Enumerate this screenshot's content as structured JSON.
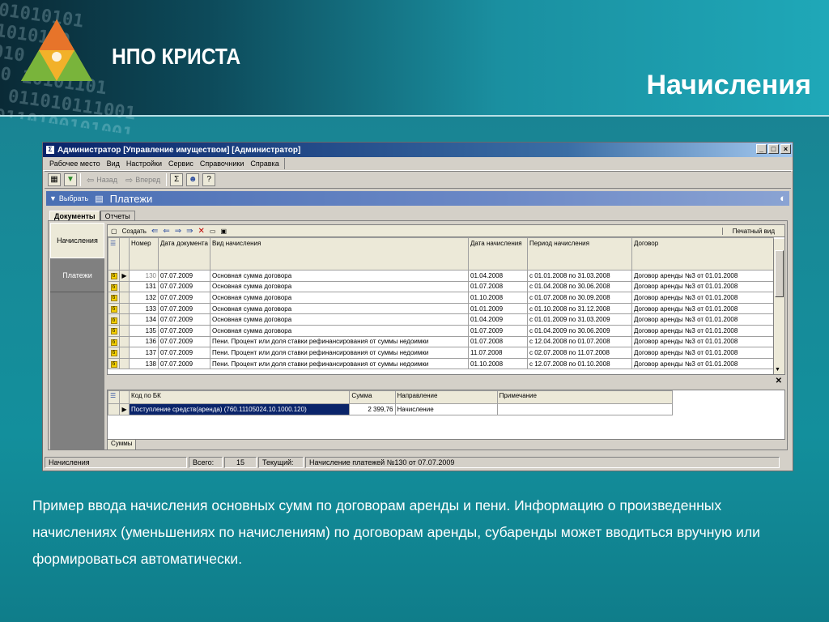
{
  "header": {
    "brand": "НПО КРИСТА",
    "page_title": "Начисления"
  },
  "window": {
    "title": "Администратор [Управление имуществом] [Администратор]",
    "menu": [
      "Рабочее место",
      "Вид",
      "Настройки",
      "Сервис",
      "Справочники",
      "Справка"
    ],
    "toolbar": {
      "back_label": "Назад",
      "forward_label": "Вперед"
    },
    "select_bar": {
      "select_label": "Выбрать",
      "title": "Платежи"
    },
    "tabs": [
      "Документы",
      "Отчеты"
    ],
    "sidebar": [
      "Начисления",
      "Платежи"
    ],
    "grid_toolbar": {
      "create_label": "Создать",
      "print_label": "Печатный вид"
    },
    "grid": {
      "columns": [
        "Номер",
        "Дата документа",
        "Вид начисления",
        "Дата начисления",
        "Период начисления",
        "Договор"
      ],
      "rows": [
        [
          "130",
          "07.07.2009",
          "Основная сумма договора",
          "01.04.2008",
          "с 01.01.2008 по 31.03.2008",
          "Договор аренды №3 от 01.01.2008"
        ],
        [
          "131",
          "07.07.2009",
          "Основная сумма договора",
          "01.07.2008",
          "с 01.04.2008 по 30.06.2008",
          "Договор аренды №3 от 01.01.2008"
        ],
        [
          "132",
          "07.07.2009",
          "Основная сумма договора",
          "01.10.2008",
          "с 01.07.2008 по 30.09.2008",
          "Договор аренды №3 от 01.01.2008"
        ],
        [
          "133",
          "07.07.2009",
          "Основная сумма договора",
          "01.01.2009",
          "с 01.10.2008 по 31.12.2008",
          "Договор аренды №3 от 01.01.2008"
        ],
        [
          "134",
          "07.07.2009",
          "Основная сумма договора",
          "01.04.2009",
          "с 01.01.2009 по 31.03.2009",
          "Договор аренды №3 от 01.01.2008"
        ],
        [
          "135",
          "07.07.2009",
          "Основная сумма договора",
          "01.07.2009",
          "с 01.04.2009 по 30.06.2009",
          "Договор аренды №3 от 01.01.2008"
        ],
        [
          "136",
          "07.07.2009",
          "Пени. Процент или доля ставки рефинансирования от суммы недоимки",
          "01.07.2008",
          "с 12.04.2008 по 01.07.2008",
          "Договор аренды №3 от 01.01.2008"
        ],
        [
          "137",
          "07.07.2009",
          "Пени. Процент или доля ставки рефинансирования от суммы недоимки",
          "11.07.2008",
          "с 02.07.2008 по 11.07.2008",
          "Договор аренды №3 от 01.01.2008"
        ],
        [
          "138",
          "07.07.2009",
          "Пени. Процент или доля ставки рефинансирования от суммы недоимки",
          "01.10.2008",
          "с 12.07.2008 по 01.10.2008",
          "Договор аренды №3 от 01.01.2008"
        ]
      ]
    },
    "grid2": {
      "columns": [
        "Код по БК",
        "Сумма",
        "Направление",
        "Примечание"
      ],
      "row": [
        "Поступление средств(аренда) (760.11105024.10.1000.120)",
        "2 399,76",
        "Начисление",
        ""
      ]
    },
    "sum_tab": "Суммы",
    "status": {
      "section": "Начисления",
      "total_label": "Всего:",
      "total_value": "15",
      "current_label": "Текущий:",
      "current_value": "Начисление платежей №130 от 07.07.2009"
    }
  },
  "caption": "Пример ввода начисления основных сумм по договорам аренды и пени. Информацию о произведенных начислениях (уменьшениях по начислениям) по договорам аренды, субаренды может вводиться вручную или формироваться автоматически.",
  "colors": {
    "teal_bg": "#138f9c",
    "title_white": "#ffffff",
    "selection": "#0a246a"
  }
}
